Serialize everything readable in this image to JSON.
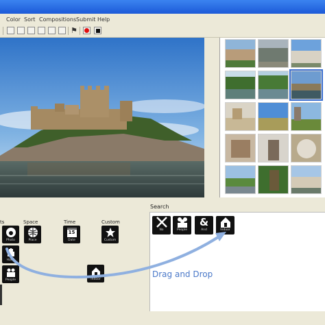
{
  "menu": [
    "Color",
    "Sort",
    "Compositions",
    "Submit",
    "Help"
  ],
  "toolbar": {
    "record_icon": "record-icon",
    "stop_icon": "stop-icon"
  },
  "categories": [
    {
      "label": "ts",
      "buttons": [
        {
          "text": "Photo"
        },
        {
          "text": "Hand"
        },
        {
          "text": "People"
        }
      ]
    },
    {
      "label": "Space",
      "buttons": [
        {
          "text": "Place"
        }
      ]
    },
    {
      "label": "Time",
      "buttons": [
        {
          "text": "Date"
        }
      ],
      "date_number": "15"
    },
    {
      "label": "Custom",
      "buttons": [
        {
          "text": "Custom"
        }
      ]
    }
  ],
  "dragged_item": {
    "text": "Indoor"
  },
  "search": {
    "label": "Search",
    "query_items": [
      {
        "text": "No"
      },
      {
        "text": "People"
      },
      {
        "text": "And"
      },
      {
        "text": "Indoor"
      }
    ],
    "hint": "Drag and Drop"
  },
  "colors": {
    "accent": "#4a78c8",
    "titlebar": "#2a6ee6",
    "record": "#e01010"
  }
}
